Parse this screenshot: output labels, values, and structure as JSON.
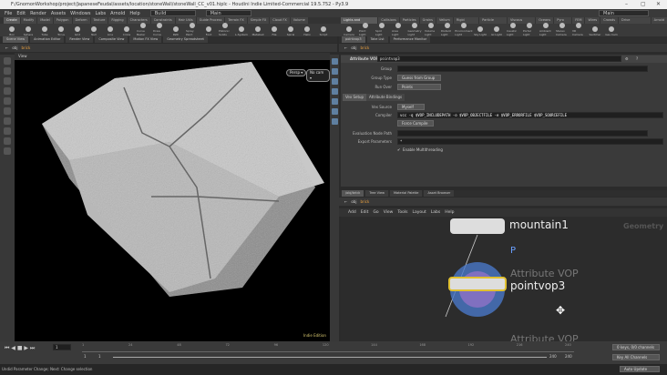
{
  "window": {
    "title": "F:/GnomonWorkshop/project/JapaneseFeudal/assets/location/stoneWall/stoneWall_CC_v01.hiplc - Houdini Indie Limited-Commercial 19.5.752 - Py3.9",
    "minimize": "–",
    "maximize": "▢",
    "close": "✕"
  },
  "menu": {
    "items": [
      "File",
      "Edit",
      "Render",
      "Assets",
      "Windows",
      "Labs",
      "Arnold",
      "Help"
    ],
    "desktop": "Build",
    "desktop_main": "Main",
    "right_desktop": "Main"
  },
  "shelf_left": {
    "tabs": [
      "Create",
      "Modify",
      "Model",
      "Polygon",
      "Deform",
      "Texture",
      "Rigging",
      "Characters",
      "Constraints",
      "Hair Utils",
      "Guide Process",
      "Terrain FX",
      "Simple FX",
      "Cloud FX",
      "Volume"
    ],
    "tools": [
      "Box",
      "Sphere",
      "Tube",
      "Torus",
      "Grid",
      "Null",
      "Line",
      "Circle",
      "Curve Bezier",
      "Draw Curve",
      "Path",
      "Spray Paint",
      "Font",
      "Platonic Solids",
      "L-System",
      "Metaball",
      "File",
      "Spiral",
      "Helix",
      "Script"
    ]
  },
  "shelf_right": {
    "tabs": [
      "Lights and Cameras",
      "Collisions",
      "Particles",
      "Grains",
      "Vellum",
      "Rigid Bodies",
      "Particle Fluids",
      "Viscous Fluids",
      "Oceans",
      "Pyro FX",
      "FEM",
      "Wires",
      "Crowds",
      "Drive Simulation",
      "Arnold"
    ],
    "tools": [
      "Camera",
      "Point Light",
      "Spot Light",
      "Area Light",
      "Geometry Light",
      "Volume Light",
      "Distant Light",
      "Environment Light",
      "Sky Light",
      "GI Light",
      "Caustic Light",
      "Portal Light",
      "Ambient Light",
      "Stereo Camera",
      "VR Camera",
      "Switcher",
      "Gas Cam"
    ]
  },
  "left_pane": {
    "tabs": [
      "Scene View",
      "Animation Editor",
      "Render View",
      "Composite View",
      "Motion FX View",
      "Geometry Spreadsheet"
    ],
    "path": [
      "obj",
      "brick"
    ],
    "view_label": "View",
    "persp": "Persp ▾",
    "camera": "No cam ▾",
    "watermark": "Indie Edition"
  },
  "right_top_pane": {
    "tabs": [
      "pointvop3",
      "Take List",
      "Performance Monitor"
    ],
    "path": [
      "obj",
      "brick"
    ]
  },
  "params": {
    "node_type": "Attribute VOP",
    "node_name": "pointvop3",
    "group_label": "Group",
    "group_value": "",
    "group_type_label": "Group Type",
    "group_type_value": "Guess from Group",
    "run_over_label": "Run Over",
    "run_over_value": "Points",
    "tabs": [
      "Vex Setup",
      "Attribute Bindings"
    ],
    "vex_source_label": "Vex Source",
    "vex_source_value": "Myself",
    "compiler_label": "Compiler",
    "compiler_value": "vcc -q $VOP_INCLUDEPATH -o $VOP_OBJECTFILE -e $VOP_ERRORFILE $VOP_SOURCEFILE",
    "force_compile": "Force Compile",
    "eval_path_label": "Evaluation Node Path",
    "eval_path_value": "",
    "export_label": "Export Parameters",
    "export_value": "*",
    "multithreading_label": "Enable Multithreading",
    "multithreading": true
  },
  "network": {
    "tabs": [
      "/obj/brick",
      "Tree View",
      "Material Palette",
      "Asset Browser"
    ],
    "path": [
      "obj",
      "brick"
    ],
    "menu": [
      "Add",
      "Edit",
      "Go",
      "View",
      "Tools",
      "Layout",
      "Labs",
      "Help"
    ],
    "context": "Geometry",
    "nodes": [
      {
        "name": "mountain1",
        "type": ""
      },
      {
        "name": "pointvop3",
        "type": "Attribute VOP"
      },
      {
        "name": "",
        "type": "Attribute VOP"
      }
    ],
    "point_label": "P"
  },
  "timeline": {
    "current_frame": "1",
    "ticks": [
      "1",
      "24",
      "48",
      "72",
      "96",
      "120",
      "144",
      "168",
      "192",
      "216",
      "240"
    ],
    "start": "1",
    "start2": "1",
    "end": "240",
    "end2": "240",
    "keys": "0 keys, 0/0 channels",
    "key_all": "Key All Channels"
  },
  "status": {
    "message": "Undid Parameter Change; Next: Change selection",
    "auto_update": "Auto Update"
  },
  "colors": {
    "accent": "#5f7fa0",
    "node_selected": "#e0c030",
    "node_vop": "#4a78c8"
  }
}
